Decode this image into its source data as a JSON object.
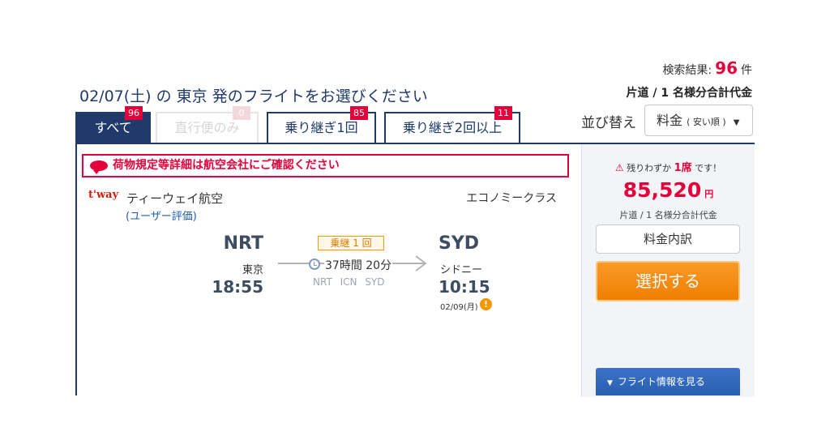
{
  "header": {
    "title": "02/07(土) の 東京 発のフライトをお選びください",
    "result_label": "検索結果:",
    "result_count": "96",
    "result_unit": "件",
    "price_basis": "片道 / 1 名様分合計代金"
  },
  "tabs": [
    {
      "label": "すべて",
      "count": "96",
      "state": "active"
    },
    {
      "label": "直行便のみ",
      "count": "0",
      "state": "disabled"
    },
    {
      "label": "乗り継ぎ1回",
      "count": "85",
      "state": "normal"
    },
    {
      "label": "乗り継ぎ2回以上",
      "count": "11",
      "state": "normal"
    }
  ],
  "sort": {
    "label": "並び替え",
    "selected": "料金",
    "selected_hint": "( 安い順 )"
  },
  "flight": {
    "notice": "荷物規定等詳細は航空会社にご確認ください",
    "airline_logo": "t'way",
    "airline_name": "ティーウェイ航空",
    "rating_link": "(ユーザー評価)",
    "cabin_class": "エコノミークラス",
    "departure": {
      "code": "NRT",
      "city": "東京",
      "time": "18:55"
    },
    "arrival": {
      "code": "SYD",
      "city": "シドニー",
      "time": "10:15",
      "date": "02/09(月)"
    },
    "stop_badge": "乗継 1 回",
    "duration": "37時間 20分",
    "via": "NRT ICN SYD"
  },
  "pricing": {
    "seats_prefix": "残りわずか",
    "seats_count": "1席",
    "seats_suffix": "です！",
    "price": "85,520",
    "currency": "円",
    "price_note": "片道 / 1 名様分合計代金",
    "breakdown_button": "料金内訳",
    "select_button": "選択する",
    "flight_info_button": "フライト情報を見る"
  },
  "icons": {
    "alert": "warning-triangle-icon",
    "chat": "speech-bubble-icon",
    "clock": "clock-icon",
    "warning_dot": "exclamation-icon",
    "sort_caret": "caret-down-icon",
    "expand": "triangle-down-icon"
  },
  "colors": {
    "primary": "#1f3a6b",
    "accent_red": "#e4003a",
    "orange": "#f39800",
    "link_blue": "#1f5cb0"
  }
}
